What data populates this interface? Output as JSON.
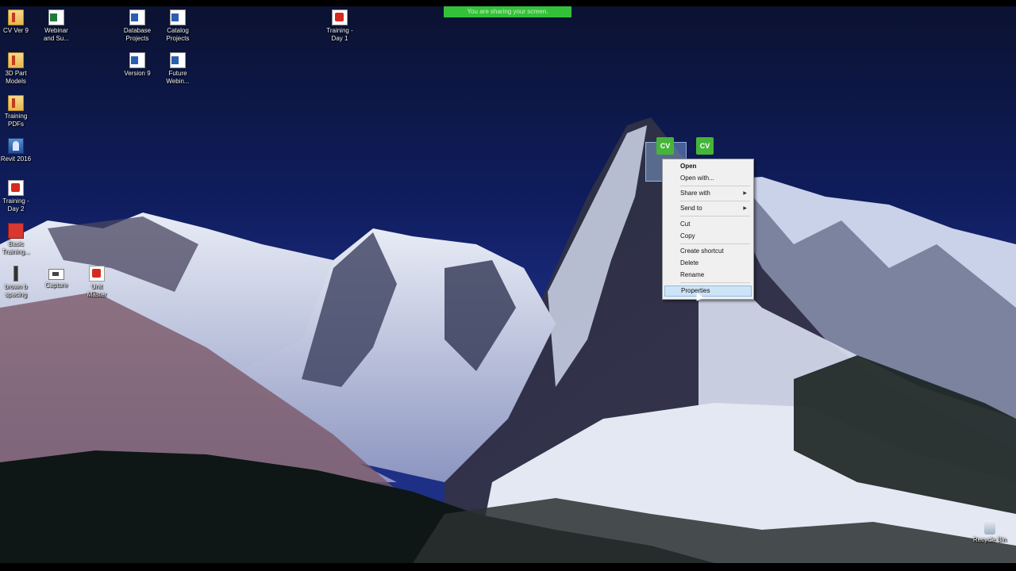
{
  "screen_share_banner": "You are sharing your screen.",
  "desktop_icons": [
    {
      "label": "CV Ver 9",
      "icon": "folder-icon"
    },
    {
      "label": "Webinar\nand Su...",
      "icon": "excel-file-icon"
    },
    {
      "label": "Database\nProjects",
      "icon": "word-file-icon"
    },
    {
      "label": "Catalog\nProjects",
      "icon": "word-file-icon"
    },
    {
      "label": "Training -\nDay 1",
      "icon": "pdf-file-icon"
    },
    {
      "label": "3D Part\nModels",
      "icon": "folder-icon"
    },
    {
      "label": "Version 9",
      "icon": "word-file-icon"
    },
    {
      "label": "Future\nWebin...",
      "icon": "word-file-icon"
    },
    {
      "label": "Training\nPDFs",
      "icon": "folder-icon"
    },
    {
      "label": "Revit 2016",
      "icon": "revit-app-icon"
    },
    {
      "label": "Training -\nDay 2",
      "icon": "pdf-file-icon"
    },
    {
      "label": "Basic\nTraining...",
      "icon": "app-icon"
    },
    {
      "label": "brown b\nspacing",
      "icon": "file-icon"
    },
    {
      "label": "Capture",
      "icon": "image-file-icon"
    },
    {
      "label": "Unit\nMaster",
      "icon": "pdf-file-icon"
    },
    {
      "label": "CV",
      "icon": "cv-app-icon"
    },
    {
      "label": "CV",
      "icon": "cv-app-icon"
    },
    {
      "label": "Recycle Bin",
      "icon": "recycle-bin-icon"
    }
  ],
  "context_menu": {
    "items": [
      {
        "label": "Open"
      },
      {
        "label": "Open with..."
      },
      {
        "label": "Share with"
      },
      {
        "label": "Send to"
      },
      {
        "label": "Cut"
      },
      {
        "label": "Copy"
      },
      {
        "label": "Create shortcut"
      },
      {
        "label": "Delete"
      },
      {
        "label": "Rename"
      },
      {
        "label": "Properties"
      }
    ]
  },
  "colors": {
    "banner": "#34c13a",
    "menu_background": "#f0f0f0",
    "menu_hover": "#cde4f7",
    "cv_badge": "#45b53a"
  }
}
